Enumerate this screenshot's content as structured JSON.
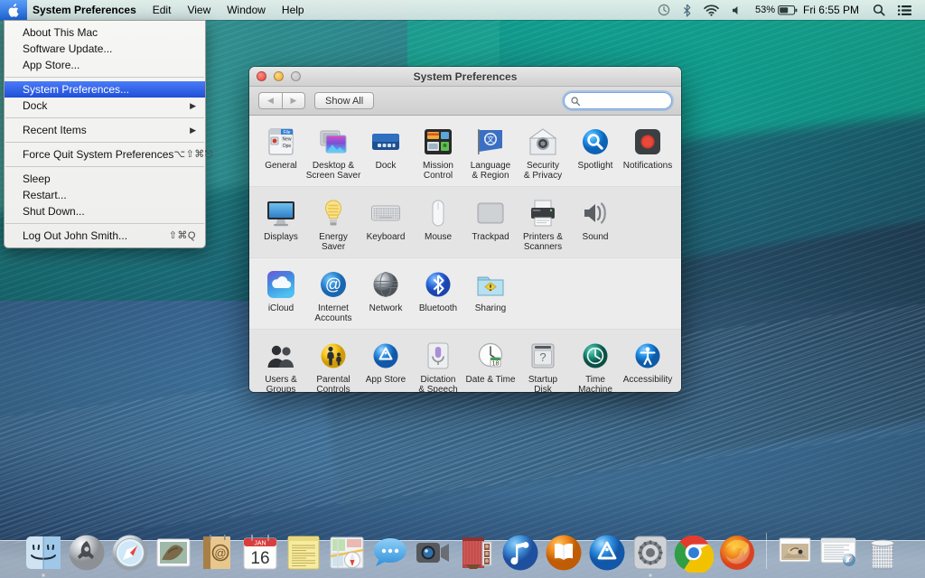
{
  "menubar": {
    "apple_icon": "apple-logo-icon",
    "app_name": "System Preferences",
    "items": [
      "Edit",
      "View",
      "Window",
      "Help"
    ],
    "status": {
      "timemachine_icon": "time-machine-icon",
      "bluetooth_icon": "bluetooth-icon",
      "wifi_icon": "wifi-icon",
      "volume_icon": "volume-icon",
      "battery_percent": "53%",
      "battery_icon": "battery-icon",
      "clock": "Fri 6:55 PM",
      "search_icon": "spotlight-search-icon",
      "notification_icon": "notification-center-icon"
    }
  },
  "apple_menu": {
    "items": [
      {
        "label": "About This Mac",
        "shortcut": "",
        "arrow": false,
        "selected": false,
        "separator_after": false
      },
      {
        "label": "Software Update...",
        "shortcut": "",
        "arrow": false,
        "selected": false,
        "separator_after": false
      },
      {
        "label": "App Store...",
        "shortcut": "",
        "arrow": false,
        "selected": false,
        "separator_after": true
      },
      {
        "label": "System Preferences...",
        "shortcut": "",
        "arrow": false,
        "selected": true,
        "separator_after": false
      },
      {
        "label": "Dock",
        "shortcut": "",
        "arrow": true,
        "selected": false,
        "separator_after": true
      },
      {
        "label": "Recent Items",
        "shortcut": "",
        "arrow": true,
        "selected": false,
        "separator_after": true
      },
      {
        "label": "Force Quit System Preferences",
        "shortcut": "⌥⇧⌘⎋",
        "arrow": false,
        "selected": false,
        "separator_after": true
      },
      {
        "label": "Sleep",
        "shortcut": "",
        "arrow": false,
        "selected": false,
        "separator_after": false
      },
      {
        "label": "Restart...",
        "shortcut": "",
        "arrow": false,
        "selected": false,
        "separator_after": false
      },
      {
        "label": "Shut Down...",
        "shortcut": "",
        "arrow": false,
        "selected": false,
        "separator_after": true
      },
      {
        "label": "Log Out John Smith...",
        "shortcut": "⇧⌘Q",
        "arrow": false,
        "selected": false,
        "separator_after": false
      }
    ]
  },
  "window": {
    "title": "System Preferences",
    "traffic_lights": [
      "close",
      "minimize",
      "zoom"
    ],
    "back_label": "◀",
    "forward_label": "▶",
    "show_all_label": "Show All",
    "search": {
      "value": "",
      "placeholder": ""
    },
    "rows": [
      {
        "shade": "light",
        "items": [
          {
            "label": "General",
            "icon": "general-icon"
          },
          {
            "label": "Desktop &\nScreen Saver",
            "icon": "desktop-screensaver-icon"
          },
          {
            "label": "Dock",
            "icon": "dock-icon"
          },
          {
            "label": "Mission\nControl",
            "icon": "mission-control-icon"
          },
          {
            "label": "Language\n& Region",
            "icon": "language-region-icon"
          },
          {
            "label": "Security\n& Privacy",
            "icon": "security-privacy-icon"
          },
          {
            "label": "Spotlight",
            "icon": "spotlight-icon"
          },
          {
            "label": "Notifications",
            "icon": "notifications-icon"
          }
        ]
      },
      {
        "shade": "dark",
        "items": [
          {
            "label": "Displays",
            "icon": "displays-icon"
          },
          {
            "label": "Energy\nSaver",
            "icon": "energy-saver-icon"
          },
          {
            "label": "Keyboard",
            "icon": "keyboard-icon"
          },
          {
            "label": "Mouse",
            "icon": "mouse-icon"
          },
          {
            "label": "Trackpad",
            "icon": "trackpad-icon"
          },
          {
            "label": "Printers &\nScanners",
            "icon": "printers-scanners-icon"
          },
          {
            "label": "Sound",
            "icon": "sound-icon"
          }
        ]
      },
      {
        "shade": "light",
        "items": [
          {
            "label": "iCloud",
            "icon": "icloud-icon"
          },
          {
            "label": "Internet\nAccounts",
            "icon": "internet-accounts-icon"
          },
          {
            "label": "Network",
            "icon": "network-icon"
          },
          {
            "label": "Bluetooth",
            "icon": "bluetooth-pref-icon"
          },
          {
            "label": "Sharing",
            "icon": "sharing-icon"
          }
        ]
      },
      {
        "shade": "dark",
        "items": [
          {
            "label": "Users &\nGroups",
            "icon": "users-groups-icon"
          },
          {
            "label": "Parental\nControls",
            "icon": "parental-controls-icon"
          },
          {
            "label": "App Store",
            "icon": "app-store-pref-icon"
          },
          {
            "label": "Dictation\n& Speech",
            "icon": "dictation-speech-icon"
          },
          {
            "label": "Date & Time",
            "icon": "date-time-icon"
          },
          {
            "label": "Startup\nDisk",
            "icon": "startup-disk-icon"
          },
          {
            "label": "Time\nMachine",
            "icon": "time-machine-pref-icon"
          },
          {
            "label": "Accessibility",
            "icon": "accessibility-icon"
          }
        ]
      }
    ]
  },
  "dock": {
    "items": [
      {
        "name": "Finder",
        "icon": "finder-icon",
        "running": true
      },
      {
        "name": "Launchpad",
        "icon": "launchpad-icon",
        "running": false
      },
      {
        "name": "Safari",
        "icon": "safari-icon",
        "running": false
      },
      {
        "name": "Mail",
        "icon": "mail-icon",
        "running": false
      },
      {
        "name": "Contacts",
        "icon": "contacts-icon",
        "running": false
      },
      {
        "name": "Calendar",
        "icon": "calendar-icon",
        "running": false
      },
      {
        "name": "Notes",
        "icon": "notes-icon",
        "running": false
      },
      {
        "name": "Maps",
        "icon": "maps-icon",
        "running": false
      },
      {
        "name": "Messages",
        "icon": "messages-icon",
        "running": false
      },
      {
        "name": "FaceTime",
        "icon": "facetime-icon",
        "running": false
      },
      {
        "name": "Photo Booth",
        "icon": "photo-booth-icon",
        "running": false
      },
      {
        "name": "iTunes",
        "icon": "itunes-icon",
        "running": false
      },
      {
        "name": "iBooks",
        "icon": "ibooks-icon",
        "running": false
      },
      {
        "name": "App Store",
        "icon": "app-store-icon",
        "running": false
      },
      {
        "name": "System Preferences",
        "icon": "system-preferences-icon",
        "running": true
      },
      {
        "name": "Google Chrome",
        "icon": "chrome-icon",
        "running": false
      },
      {
        "name": "Firefox",
        "icon": "firefox-icon",
        "running": false
      }
    ],
    "minimized": [
      {
        "name": "Preview window",
        "icon": "minimized-photo-window"
      },
      {
        "name": "Safari window",
        "icon": "minimized-safari-window"
      }
    ],
    "trash": {
      "name": "Trash",
      "icon": "trash-icon"
    },
    "calendar_month": "JAN",
    "calendar_day": "16"
  }
}
